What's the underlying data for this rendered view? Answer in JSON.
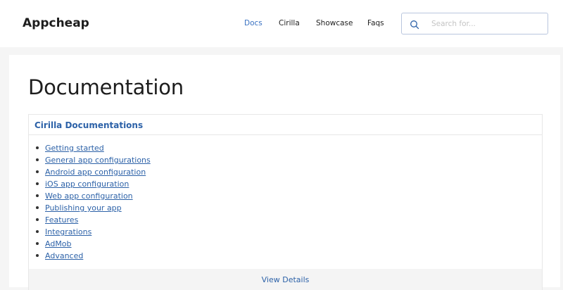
{
  "brand": "Appcheap",
  "nav": [
    {
      "label": "Docs",
      "active": true
    },
    {
      "label": "Cirilla",
      "active": false
    },
    {
      "label": "Showcase",
      "active": false
    },
    {
      "label": "Faqs",
      "active": false
    }
  ],
  "search": {
    "placeholder": "Search for...",
    "value": "",
    "icon": "search-icon"
  },
  "page_title": "Documentation",
  "card": {
    "title": "Cirilla Documentations",
    "items": [
      "Getting started",
      "General app configurations",
      "Android app configuration",
      "iOS app configuration",
      "Web app configuration",
      "Publishing your app",
      "Features",
      "Integrations",
      "AdMob",
      "Advanced"
    ],
    "footer_link": "View Details"
  },
  "colors": {
    "accent": "#2d62a8",
    "nav_active": "#3a72c2",
    "background": "#f5f5f5"
  }
}
